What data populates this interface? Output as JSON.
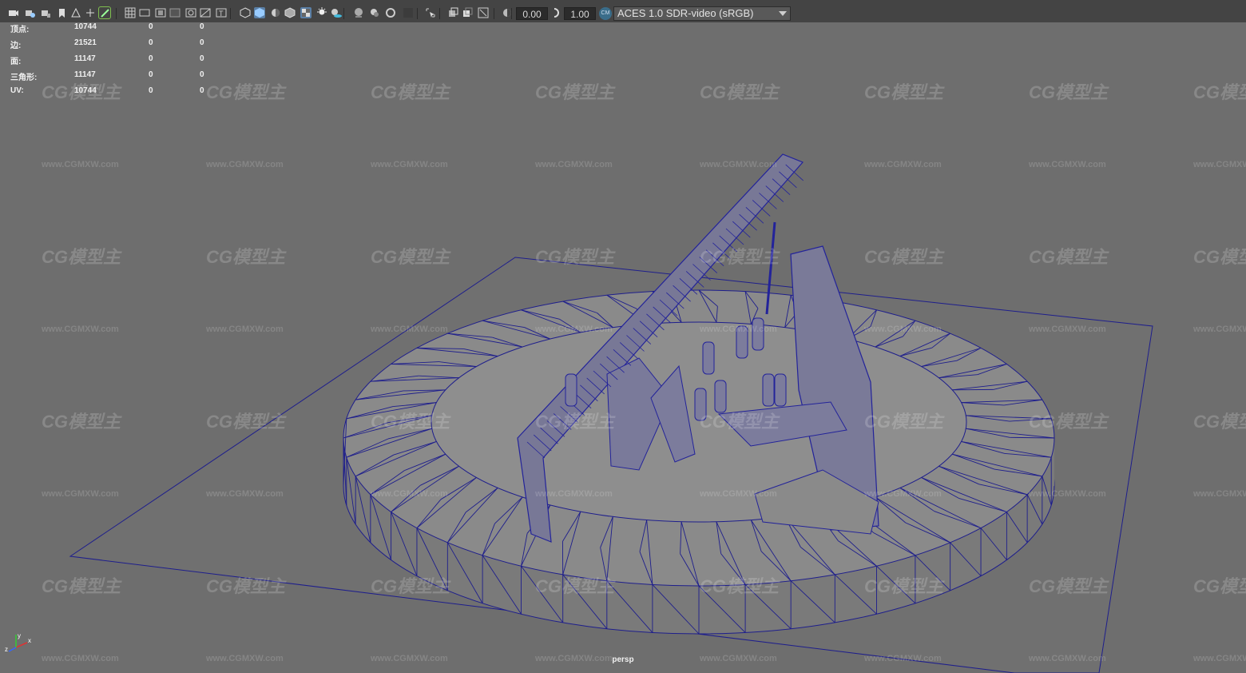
{
  "toolbar": {
    "menu_fragments": [
      "",
      "",
      "",
      "",
      "",
      ""
    ],
    "exposure_value": "0.00",
    "gamma_value": "1.00",
    "color_space": "ACES 1.0 SDR-video (sRGB)",
    "icons": [
      "camera-icon",
      "camera-attr-icon",
      "camera-lock-icon",
      "bookmark-icon",
      "image-plane-icon",
      "2d-pan-icon",
      "grease-pencil-icon",
      "grid-icon",
      "film-gate-icon",
      "resolution-gate-icon",
      "gate-mask-icon",
      "field-chart-icon",
      "safe-action-icon",
      "safe-title-icon",
      "wireframe-icon",
      "smooth-shade-icon",
      "use-default-material-icon",
      "wireframe-on-shaded-icon",
      "textured-icon",
      "use-all-lights-icon",
      "shadows-icon",
      "screen-space-ao-icon",
      "motion-blur-icon",
      "anti-aliasing-icon",
      "depth-of-field-icon",
      "isolate-select-icon",
      "xray-icon",
      "xray-active-icon",
      "xray-joints-icon",
      "backface-culling-icon",
      "exposure-icon",
      "gamma-icon",
      "color-management-icon"
    ]
  },
  "hud": {
    "rows": [
      {
        "label": "顶点:",
        "v1": "10744",
        "v2": "0",
        "v3": "0"
      },
      {
        "label": "边:",
        "v1": "21521",
        "v2": "0",
        "v3": "0"
      },
      {
        "label": "面:",
        "v1": "11147",
        "v2": "0",
        "v3": "0"
      },
      {
        "label": "三角形:",
        "v1": "11147",
        "v2": "0",
        "v3": "0"
      },
      {
        "label": "UV:",
        "v1": "10744",
        "v2": "0",
        "v3": "0"
      }
    ]
  },
  "viewport": {
    "camera": "persp",
    "axis_labels": {
      "x": "x",
      "y": "y",
      "z": "z"
    },
    "watermark_big": "CG模型主",
    "watermark_small": "www.CGMXW.com",
    "colors": {
      "background": "#6e6e6e",
      "wire": "#1e1e8c",
      "wire_dense": "#23239a",
      "surface": "#8a8a8a",
      "surface_dark": "#7a7a7a"
    }
  }
}
